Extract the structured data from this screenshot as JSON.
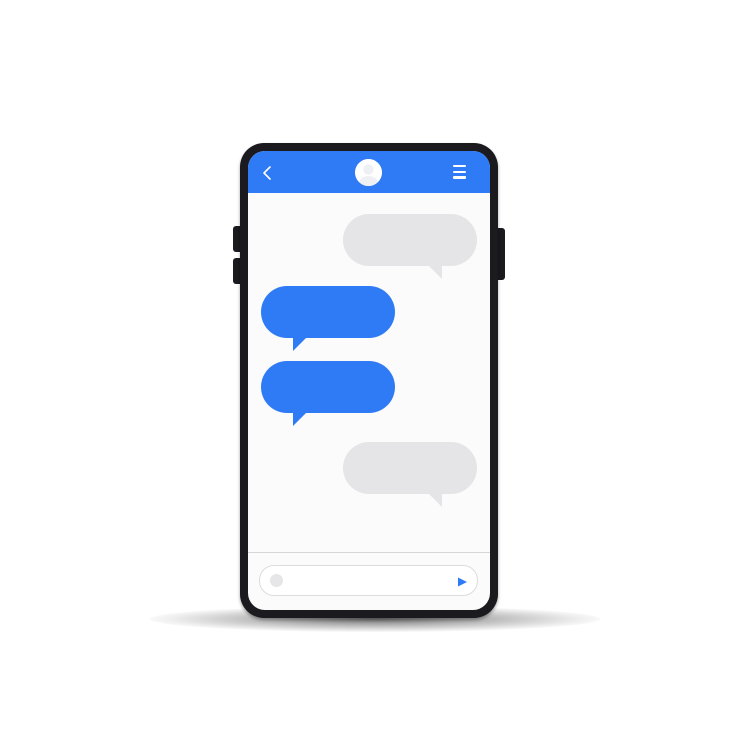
{
  "colors": {
    "accent": "#2f7bf6",
    "incoming_bubble": "#e5e5e7",
    "phone_body": "#1b1b1f",
    "screen_background": "#fbfbfb"
  },
  "header": {
    "back_icon": "chevron-left-icon",
    "avatar_icon": "avatar",
    "menu_icon": "hamburger-menu-icon"
  },
  "messages": [
    {
      "direction": "incoming",
      "text": ""
    },
    {
      "direction": "outgoing",
      "text": ""
    },
    {
      "direction": "outgoing",
      "text": ""
    },
    {
      "direction": "incoming",
      "text": ""
    }
  ],
  "composer": {
    "value": "",
    "placeholder": "",
    "attach_icon": "attach-icon",
    "send_icon": "send-icon"
  }
}
